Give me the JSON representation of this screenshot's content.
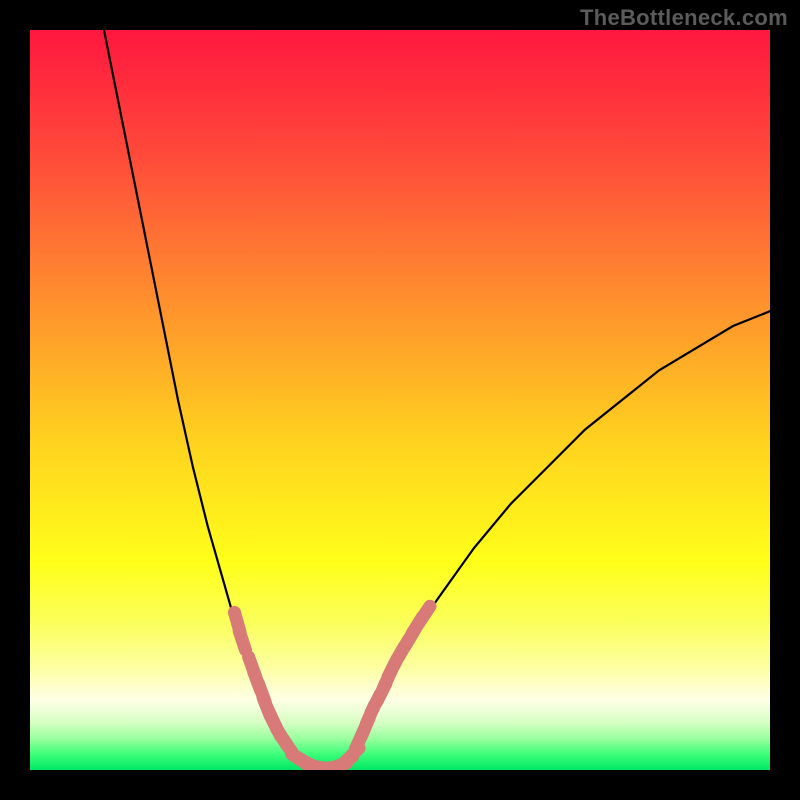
{
  "watermark": "TheBottleneck.com",
  "chart_data": {
    "type": "line",
    "title": "",
    "xlabel": "",
    "ylabel": "",
    "xlim": [
      0,
      100
    ],
    "ylim": [
      0,
      100
    ],
    "grid": false,
    "legend": false,
    "gradient_stops": [
      {
        "pos": 0.0,
        "color": "#ff173f"
      },
      {
        "pos": 0.17,
        "color": "#ff4a3a"
      },
      {
        "pos": 0.35,
        "color": "#ff8a2f"
      },
      {
        "pos": 0.55,
        "color": "#ffd01f"
      },
      {
        "pos": 0.72,
        "color": "#ffff1a"
      },
      {
        "pos": 0.8,
        "color": "#fbff5a"
      },
      {
        "pos": 0.86,
        "color": "#fdffa0"
      },
      {
        "pos": 0.905,
        "color": "#ffffe6"
      },
      {
        "pos": 0.935,
        "color": "#d8ffc5"
      },
      {
        "pos": 0.958,
        "color": "#97ff9d"
      },
      {
        "pos": 0.978,
        "color": "#3fff7a"
      },
      {
        "pos": 1.0,
        "color": "#00e765"
      }
    ],
    "series": [
      {
        "name": "left-branch",
        "color": "#000000",
        "x": [
          10,
          12,
          14,
          16,
          18,
          20,
          22,
          24,
          26,
          28,
          30,
          31,
          32,
          33,
          34,
          35,
          36,
          37,
          38
        ],
        "y": [
          100,
          90,
          80,
          70,
          60,
          50,
          41,
          33,
          26,
          19,
          13,
          10,
          8,
          6,
          4.5,
          3,
          2,
          1.2,
          0.6
        ]
      },
      {
        "name": "right-branch",
        "color": "#000000",
        "x": [
          42,
          43,
          44,
          45,
          47,
          50,
          55,
          60,
          65,
          70,
          75,
          80,
          85,
          90,
          95,
          100
        ],
        "y": [
          0.6,
          1.5,
          3,
          5,
          9,
          15,
          23,
          30,
          36,
          41,
          46,
          50,
          54,
          57,
          60,
          62
        ]
      },
      {
        "name": "valley-floor",
        "color": "#000000",
        "x": [
          38,
          39,
          40,
          41,
          42
        ],
        "y": [
          0.6,
          0.3,
          0.2,
          0.3,
          0.6
        ]
      }
    ],
    "markers": [
      {
        "name": "left-markers",
        "color": "#d77a78",
        "points": [
          {
            "x": 28.0,
            "y": 20.0
          },
          {
            "x": 28.7,
            "y": 17.5
          },
          {
            "x": 30.0,
            "y": 14.0
          },
          {
            "x": 30.7,
            "y": 12.0
          },
          {
            "x": 31.3,
            "y": 10.5
          },
          {
            "x": 32.0,
            "y": 8.5
          },
          {
            "x": 32.7,
            "y": 7.0
          },
          {
            "x": 33.3,
            "y": 5.7
          },
          {
            "x": 34.0,
            "y": 4.5
          },
          {
            "x": 35.0,
            "y": 3.0
          }
        ]
      },
      {
        "name": "valley-markers",
        "color": "#d77a78",
        "points": [
          {
            "x": 36.5,
            "y": 1.5
          },
          {
            "x": 37.5,
            "y": 0.9
          },
          {
            "x": 38.5,
            "y": 0.5
          },
          {
            "x": 39.5,
            "y": 0.3
          },
          {
            "x": 40.5,
            "y": 0.3
          },
          {
            "x": 41.5,
            "y": 0.5
          },
          {
            "x": 42.5,
            "y": 1.0
          },
          {
            "x": 43.5,
            "y": 2.0
          }
        ]
      },
      {
        "name": "right-markers",
        "color": "#d77a78",
        "points": [
          {
            "x": 44.5,
            "y": 4.0
          },
          {
            "x": 45.3,
            "y": 5.8
          },
          {
            "x": 46.0,
            "y": 7.5
          },
          {
            "x": 46.7,
            "y": 9.0
          },
          {
            "x": 47.5,
            "y": 10.5
          },
          {
            "x": 48.3,
            "y": 12.3
          },
          {
            "x": 49.0,
            "y": 13.8
          },
          {
            "x": 49.8,
            "y": 15.3
          },
          {
            "x": 50.5,
            "y": 16.5
          },
          {
            "x": 51.3,
            "y": 17.8
          },
          {
            "x": 52.3,
            "y": 19.5
          },
          {
            "x": 53.3,
            "y": 21.0
          }
        ]
      }
    ]
  }
}
